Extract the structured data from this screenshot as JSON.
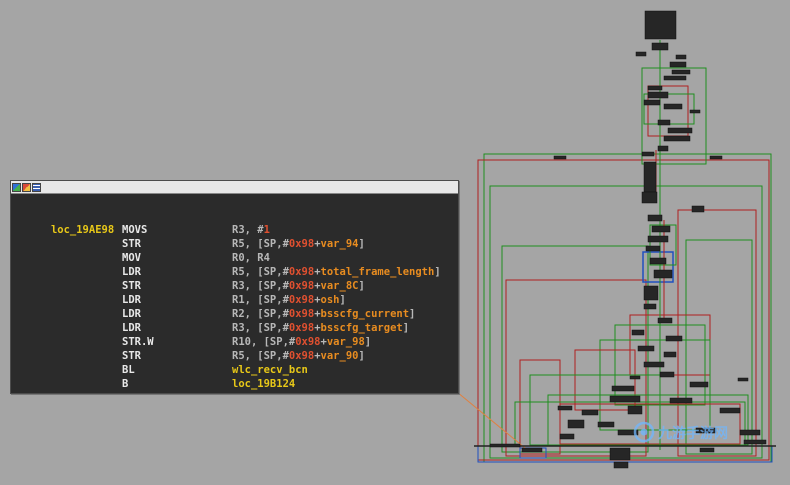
{
  "app": {
    "name": "IDA graph view",
    "view": "function-graph-overview"
  },
  "node": {
    "label": "loc_19AE98",
    "toolbar_icons": [
      "graph-color-icon",
      "palette-icon",
      "text-view-icon"
    ],
    "instructions": [
      {
        "mnemonic": "MOVS",
        "operands": [
          {
            "t": "reg",
            "v": "R3, #"
          },
          {
            "t": "num",
            "v": "1"
          }
        ]
      },
      {
        "mnemonic": "STR",
        "operands": [
          {
            "t": "reg",
            "v": "R5, [SP,#"
          },
          {
            "t": "num",
            "v": "0x98"
          },
          {
            "t": "reg",
            "v": "+"
          },
          {
            "t": "var",
            "v": "var_94"
          },
          {
            "t": "reg",
            "v": "]"
          }
        ]
      },
      {
        "mnemonic": "MOV",
        "operands": [
          {
            "t": "reg",
            "v": "R0, R4"
          }
        ]
      },
      {
        "mnemonic": "LDR",
        "operands": [
          {
            "t": "reg",
            "v": "R5, [SP,#"
          },
          {
            "t": "num",
            "v": "0x98"
          },
          {
            "t": "reg",
            "v": "+"
          },
          {
            "t": "var",
            "v": "total_frame_length"
          },
          {
            "t": "reg",
            "v": "]"
          }
        ]
      },
      {
        "mnemonic": "STR",
        "operands": [
          {
            "t": "reg",
            "v": "R3, [SP,#"
          },
          {
            "t": "num",
            "v": "0x98"
          },
          {
            "t": "reg",
            "v": "+"
          },
          {
            "t": "var",
            "v": "var_8C"
          },
          {
            "t": "reg",
            "v": "]"
          }
        ]
      },
      {
        "mnemonic": "LDR",
        "operands": [
          {
            "t": "reg",
            "v": "R1, [SP,#"
          },
          {
            "t": "num",
            "v": "0x98"
          },
          {
            "t": "reg",
            "v": "+"
          },
          {
            "t": "var",
            "v": "osh"
          },
          {
            "t": "reg",
            "v": "]"
          }
        ]
      },
      {
        "mnemonic": "LDR",
        "operands": [
          {
            "t": "reg",
            "v": "R2, [SP,#"
          },
          {
            "t": "num",
            "v": "0x98"
          },
          {
            "t": "reg",
            "v": "+"
          },
          {
            "t": "var",
            "v": "bsscfg_current"
          },
          {
            "t": "reg",
            "v": "]"
          }
        ]
      },
      {
        "mnemonic": "LDR",
        "operands": [
          {
            "t": "reg",
            "v": "R3, [SP,#"
          },
          {
            "t": "num",
            "v": "0x98"
          },
          {
            "t": "reg",
            "v": "+"
          },
          {
            "t": "var",
            "v": "bsscfg_target"
          },
          {
            "t": "reg",
            "v": "]"
          }
        ]
      },
      {
        "mnemonic": "STR.W",
        "operands": [
          {
            "t": "reg",
            "v": "R10, [SP,#"
          },
          {
            "t": "num",
            "v": "0x98"
          },
          {
            "t": "reg",
            "v": "+"
          },
          {
            "t": "var",
            "v": "var_98"
          },
          {
            "t": "reg",
            "v": "]"
          }
        ]
      },
      {
        "mnemonic": "STR",
        "operands": [
          {
            "t": "reg",
            "v": "R5, [SP,#"
          },
          {
            "t": "num",
            "v": "0x98"
          },
          {
            "t": "reg",
            "v": "+"
          },
          {
            "t": "var",
            "v": "var_90"
          },
          {
            "t": "reg",
            "v": "]"
          }
        ]
      },
      {
        "mnemonic": "BL",
        "operands": [
          {
            "t": "fn",
            "v": "wlc_recv_bcn"
          }
        ]
      },
      {
        "mnemonic": "B",
        "operands": [
          {
            "t": "fn",
            "v": "loc_19B124"
          }
        ]
      }
    ]
  },
  "watermark": "九游手游网",
  "colors": {
    "background": "#a5a5a5",
    "node_bg": "#2b2b2b",
    "label": "#e8c818",
    "mnemonic": "#e8e8e8",
    "register": "#b8b8b8",
    "number": "#e05030",
    "variable": "#e88c20",
    "edge_true": "#1f8f1f",
    "edge_false": "#b02020",
    "edge_uncond": "#2050c0",
    "selected_edge": "#e08040"
  }
}
